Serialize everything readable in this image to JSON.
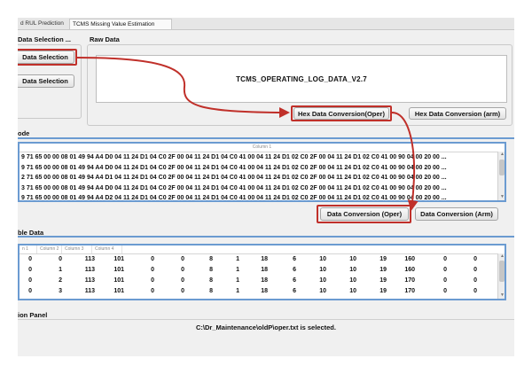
{
  "tabs": [
    "d RUL Prediction",
    "TCMS  Missing Value Estimation"
  ],
  "data_selection_panel": {
    "title": "Data Selection ...",
    "buttons": [
      "Data Selection",
      "Data Selection"
    ]
  },
  "raw_data_panel": {
    "title": "Raw Data",
    "file_label": "TCMS_OPERATING_LOG_DATA_V2.7",
    "buttons": [
      "Hex Data Conversion(Oper)",
      "Hex Data Conversion (arm)"
    ]
  },
  "hex_panel": {
    "title": "ode",
    "column_header": "Column 1",
    "rows": [
      "9 71 65 00 00 08 01 49 94 A4 D0 04 11 24 D1 04 C0 2F 00 04 11 24 D1 04 C0 41 00 04 11 24 D1 02 C0 2F 00 04 11 24 D1 02 C0 41 00 90 04 00 20 00 ...",
      "9 71 65 00 00 08 01 49 94 A4 D0 04 11 24 D1 04 C0 2F 00 04 11 24 D1 04 C0 41 00 04 11 24 D1 02 C0 2F 00 04 11 24 D1 02 C0 41 00 90 04 00 20 00 ...",
      "2 71 65 00 00 08 01 49 94 A4 D1 04 11 24 D1 04 C0 2F 00 04 11 24 D1 04 C0 41 00 04 11 24 D1 02 C0 2F 00 04 11 24 D1 02 C0 41 00 90 04 00 20 00 ...",
      "3 71 65 00 00 08 01 49 94 A4 D0 04 11 24 D1 04 C0 2F 00 04 11 24 D1 04 C0 41 00 04 11 24 D1 02 C0 2F 00 04 11 24 D1 02 C0 41 00 90 04 00 20 00 ...",
      "9 71 65 00 00 08 01 49 94 A4 D2 04 11 24 D1 04 C0 2F 00 04 11 24 D1 04 C0 41 00 04 11 24 D1 02 C0 2F 00 04 11 24 D1 02 C0 41 00 90 04 00 20 00 ..."
    ],
    "buttons": [
      "Data Conversion (Oper)",
      "Data Conversion (Arm)"
    ]
  },
  "table_panel": {
    "title": "ble Data",
    "columns": [
      "n 1",
      "Column 2",
      "Column 3",
      "Column 4"
    ],
    "rows": [
      [
        "0",
        "0",
        "113",
        "101",
        "0",
        "0",
        "8",
        "1",
        "18",
        "6",
        "10",
        "10",
        "19",
        "160",
        "0",
        "0"
      ],
      [
        "0",
        "1",
        "113",
        "101",
        "0",
        "0",
        "8",
        "1",
        "18",
        "6",
        "10",
        "10",
        "19",
        "160",
        "0",
        "0"
      ],
      [
        "0",
        "2",
        "113",
        "101",
        "0",
        "0",
        "8",
        "1",
        "18",
        "6",
        "10",
        "10",
        "19",
        "170",
        "0",
        "0"
      ],
      [
        "0",
        "3",
        "113",
        "101",
        "0",
        "0",
        "8",
        "1",
        "18",
        "6",
        "10",
        "10",
        "19",
        "170",
        "0",
        "0"
      ]
    ]
  },
  "status_panel": {
    "title": "ion Panel",
    "message": "C:\\Dr_Maintenance\\oldP\\oper.txt is selected."
  },
  "colors": {
    "highlight_red": "#c0302a",
    "focus_blue": "#6b9bd1"
  }
}
